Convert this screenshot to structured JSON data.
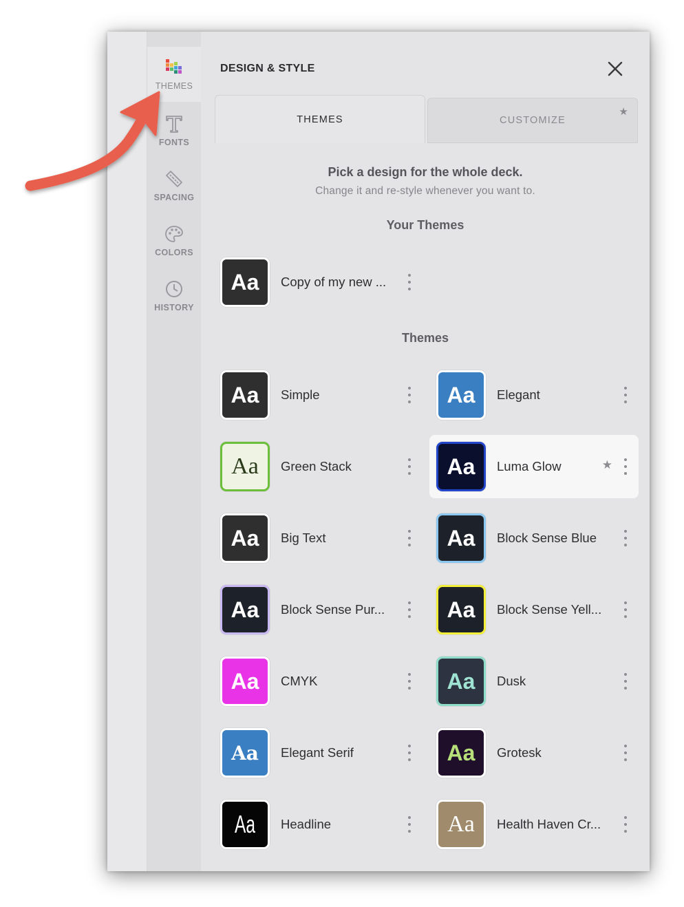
{
  "sidenav": {
    "items": [
      {
        "label": "THEMES",
        "icon": "themes-palette-icon"
      },
      {
        "label": "FONTS",
        "icon": "text-t-icon"
      },
      {
        "label": "SPACING",
        "icon": "ruler-icon"
      },
      {
        "label": "COLORS",
        "icon": "paint-palette-icon"
      },
      {
        "label": "HISTORY",
        "icon": "clock-icon"
      }
    ]
  },
  "header": {
    "title": "DESIGN & STYLE",
    "close_icon": "close-icon"
  },
  "tabs": [
    {
      "label": "THEMES",
      "active": true
    },
    {
      "label": "CUSTOMIZE",
      "active": false,
      "icon": "star-icon"
    }
  ],
  "intro": {
    "title": "Pick a design for the whole deck.",
    "subtitle": "Change it and re-style whenever you want to."
  },
  "your_themes": {
    "title": "Your Themes",
    "items": [
      {
        "name": "Copy of my new ...",
        "sample": "Aa",
        "bg": "#2f2f2f",
        "fg": "#ffffff",
        "border": "#ffffff"
      }
    ]
  },
  "themes": {
    "title": "Themes",
    "items": [
      {
        "name": "Simple",
        "sample": "Aa",
        "bg": "#2f2f2f",
        "fg": "#ffffff",
        "border": "#ffffff"
      },
      {
        "name": "Elegant",
        "sample": "Aa",
        "bg": "#3a7fc1",
        "fg": "#ffffff",
        "border": "#ffffff"
      },
      {
        "name": "Green Stack",
        "sample": "Aa",
        "bg": "#eef3e4",
        "fg": "#2a3a1a",
        "border": "#6cbf3a"
      },
      {
        "name": "Luma Glow",
        "sample": "Aa",
        "bg": "#0a0f2e",
        "fg": "#ffffff",
        "border": "#2345c9",
        "selected": true,
        "starred": true
      },
      {
        "name": "Big Text",
        "sample": "Aa",
        "bg": "#2f2f2f",
        "fg": "#ffffff",
        "border": "#ffffff"
      },
      {
        "name": "Block Sense Blue",
        "sample": "Aa",
        "bg": "#1d2129",
        "fg": "#ffffff",
        "border": "#8cc7f0"
      },
      {
        "name": "Block Sense Pur...",
        "sample": "Aa",
        "bg": "#1d2129",
        "fg": "#ffffff",
        "border": "#c9b8f2"
      },
      {
        "name": "Block Sense Yell...",
        "sample": "Aa",
        "bg": "#1d2129",
        "fg": "#ffffff",
        "border": "#f3ef3a"
      },
      {
        "name": "CMYK",
        "sample": "Aa",
        "bg": "#e834e6",
        "fg": "#ffffff",
        "border": "#ffffff"
      },
      {
        "name": "Dusk",
        "sample": "Aa",
        "bg": "#2d3340",
        "fg": "#9fe3d3",
        "border": "#8fdcc9"
      },
      {
        "name": "Elegant Serif",
        "sample": "Aa",
        "bg": "#3a7fc1",
        "fg": "#ffffff",
        "border": "#ffffff"
      },
      {
        "name": "Grotesk",
        "sample": "Aa",
        "bg": "#1f0f2a",
        "fg": "#b7e07a",
        "border": "#ffffff"
      },
      {
        "name": "Headline",
        "sample": "Aa",
        "bg": "#050505",
        "fg": "#ffffff",
        "border": "#ffffff"
      },
      {
        "name": "Health Haven Cr...",
        "sample": "Aa",
        "bg": "#a08c6c",
        "fg": "#ffffff",
        "border": "#ffffff"
      }
    ]
  },
  "accent_arrow_color": "#e8604e"
}
